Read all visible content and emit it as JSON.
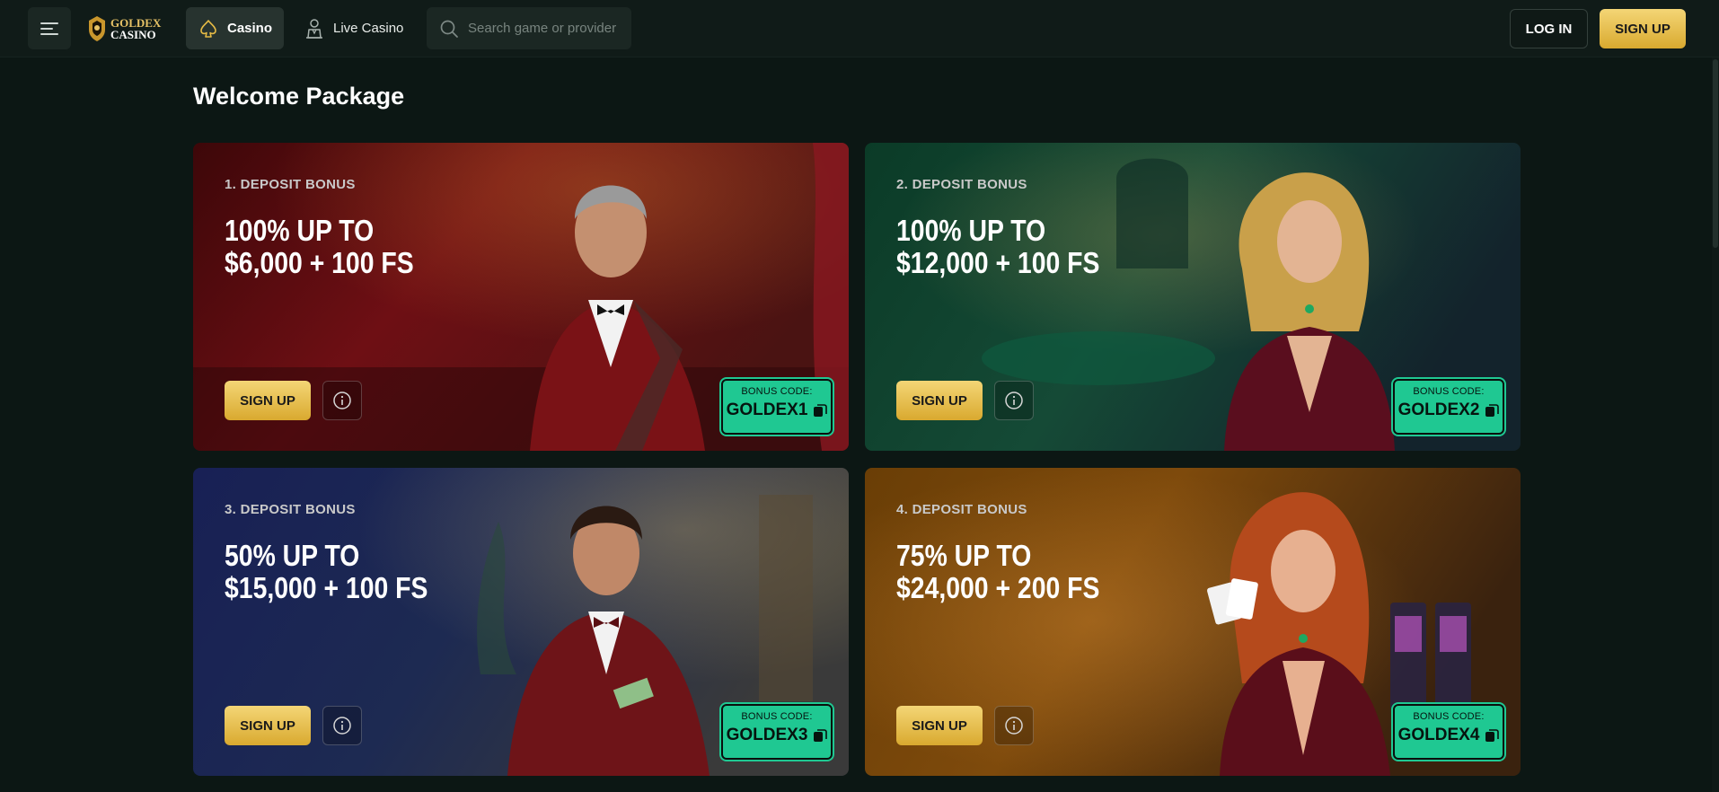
{
  "header": {
    "logo_line1": "GOLDEX",
    "logo_line2": "CASINO",
    "nav": {
      "casino": "Casino",
      "live_casino": "Live Casino"
    },
    "search": {
      "placeholder": "Search game or provider"
    },
    "login_label": "LOG IN",
    "signup_label": "SIGN UP"
  },
  "main": {
    "title": "Welcome Package",
    "bonuses": [
      {
        "label": "1. DEPOSIT BONUS",
        "line1": "100% UP TO",
        "line2": "$6,000 + 100 FS",
        "signup": "SIGN UP",
        "code_label": "BONUS CODE:",
        "code": "GOLDEX1"
      },
      {
        "label": "2. DEPOSIT BONUS",
        "line1": "100% UP TO",
        "line2": "$12,000 + 100 FS",
        "signup": "SIGN UP",
        "code_label": "BONUS CODE:",
        "code": "GOLDEX2"
      },
      {
        "label": "3. DEPOSIT BONUS",
        "line1": "50% UP TO",
        "line2": "$15,000 + 100 FS",
        "signup": "SIGN UP",
        "code_label": "BONUS CODE:",
        "code": "GOLDEX3"
      },
      {
        "label": "4. DEPOSIT BONUS",
        "line1": "75% UP TO",
        "line2": "$24,000 + 200 FS",
        "signup": "SIGN UP",
        "code_label": "BONUS CODE:",
        "code": "GOLDEX4"
      }
    ]
  },
  "icons": {
    "menu": "hamburger-menu-icon",
    "casino": "spade-icon",
    "live_casino": "dealer-icon",
    "search": "search-icon",
    "info": "info-icon",
    "copy": "copy-icon"
  },
  "colors": {
    "background": "#0c1714",
    "accent_gold": "#e6bb45",
    "bonus_code_green": "#1fc892",
    "card1": "#6e0f14",
    "card2": "#0f4a33",
    "card3": "#1c2358",
    "card4": "#7a4a09"
  }
}
